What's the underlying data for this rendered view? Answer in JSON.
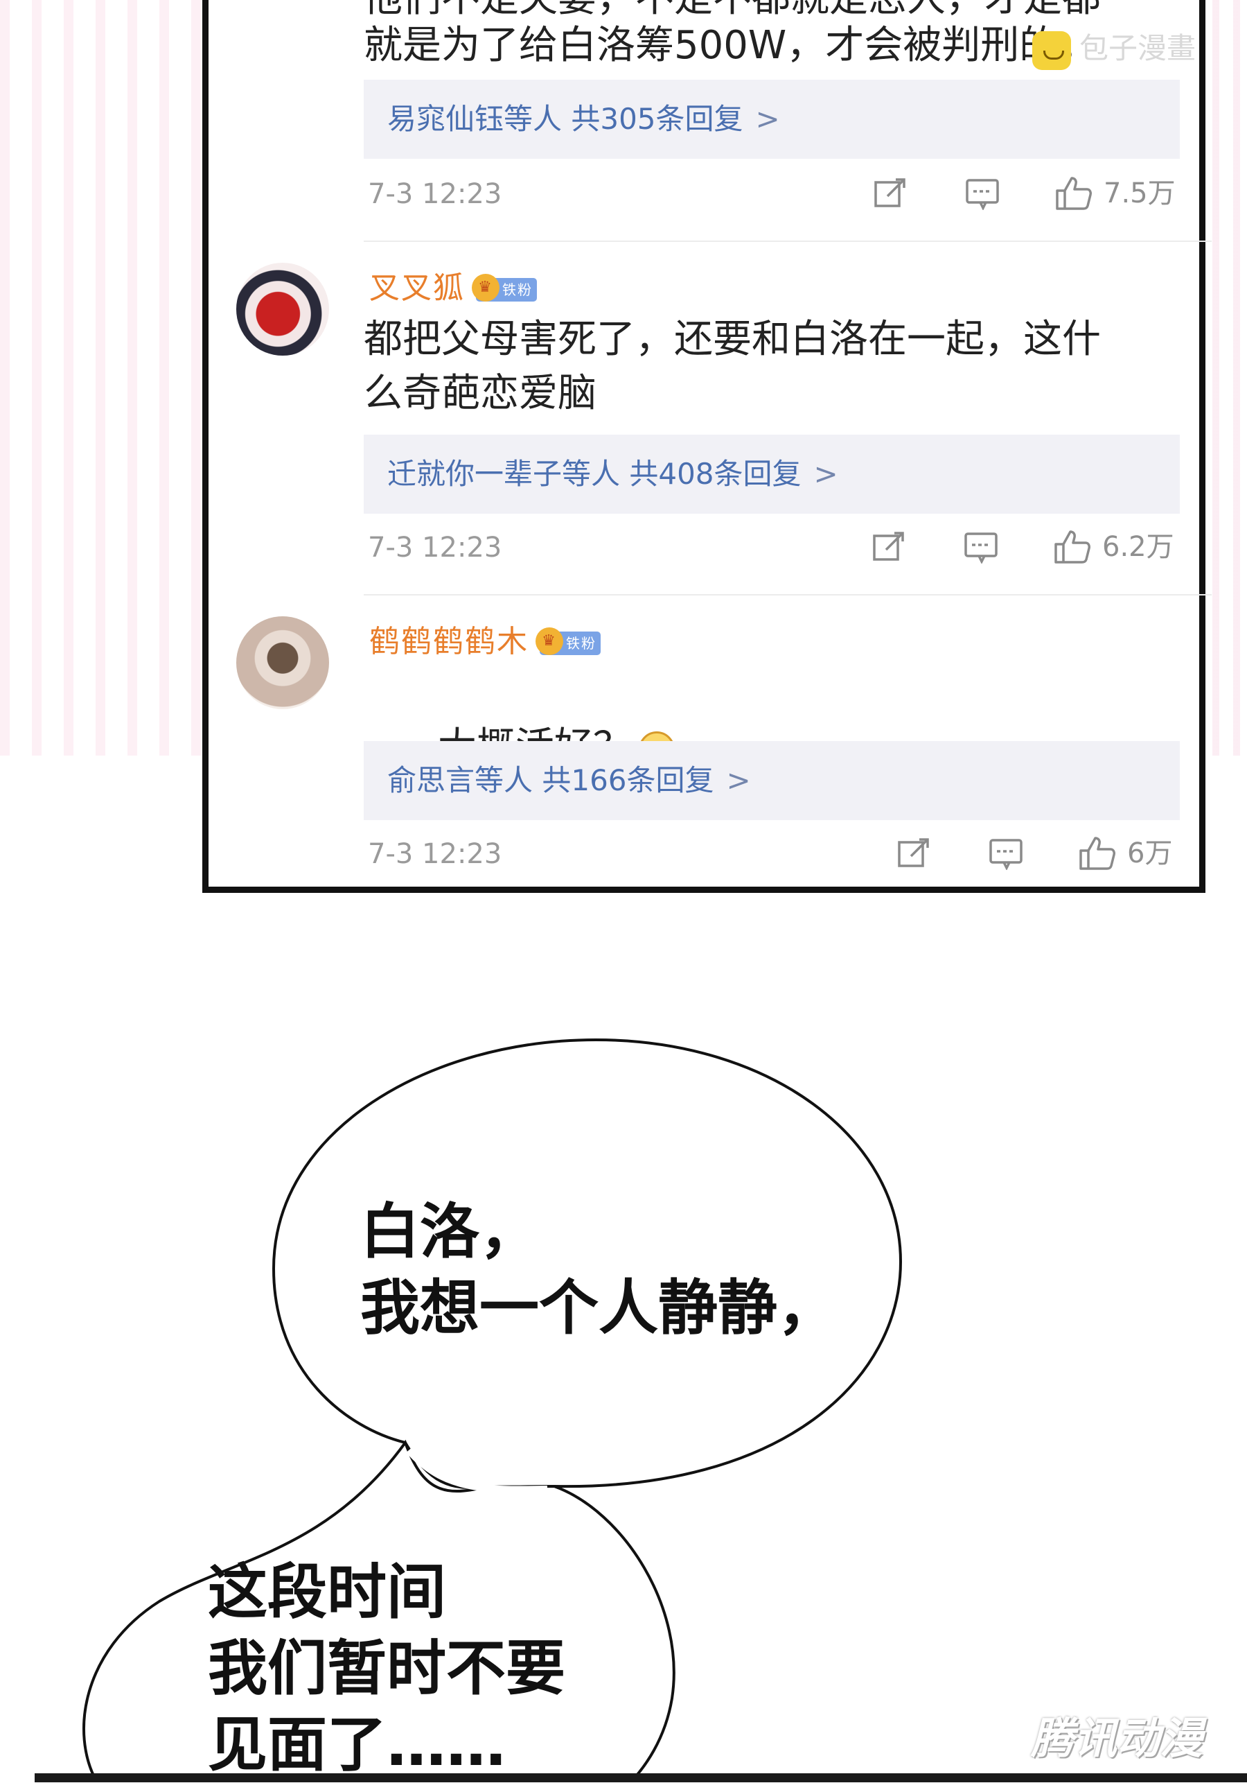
{
  "watermark_top": "包子漫畫",
  "partial_comment": {
    "top_line": "他们不是夫妻，不是不都就是恋人，才是都",
    "text": "就是为了给白洛筹500W，才会被判刑的。",
    "reply_label": "易窕仙钰等人 共305条回复",
    "time": "7-3 12:23",
    "likes": "7.5万"
  },
  "comments": [
    {
      "username": "叉叉狐",
      "badge": "铁粉",
      "text": "都把父母害死了，还要和白洛在一起，这什\n么奇葩恋爱脑",
      "reply_label": "迁就你一辈子等人 共408条回复",
      "time": "7-3 12:23",
      "likes": "6.2万"
    },
    {
      "username": "鹤鹤鹤鹤木",
      "badge": "铁粉",
      "text": "大概活好？",
      "reply_label": "俞思言等人 共166条回复",
      "time": "7-3 12:23",
      "likes": "6万"
    }
  ],
  "chevron": ">",
  "bubbles": [
    {
      "text": "白洛，\n我想一个人静静，"
    },
    {
      "text": "这段时间\n我们暂时不要\n见面了……"
    }
  ],
  "bottom_watermark": "腾讯动漫",
  "icons": [
    "share-icon",
    "comment-icon",
    "like-icon",
    "emoji-grin-icon"
  ]
}
